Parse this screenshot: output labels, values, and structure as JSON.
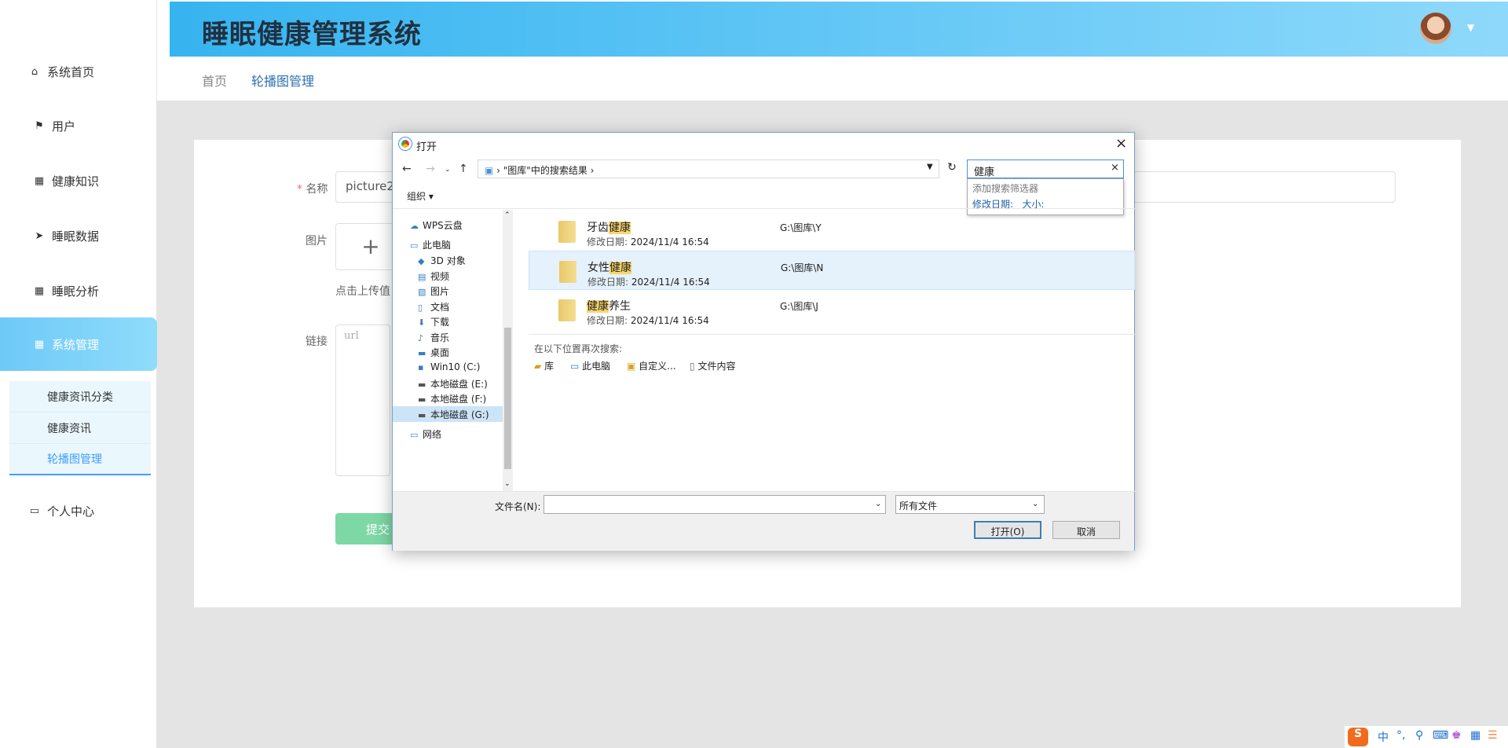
{
  "sidebar": {
    "items": [
      {
        "label": "系统首页",
        "icon": "home-icon"
      },
      {
        "label": "用户",
        "icon": "flag-icon"
      },
      {
        "label": "健康知识",
        "icon": "grid-icon"
      },
      {
        "label": "睡眠数据",
        "icon": "send-icon"
      },
      {
        "label": "睡眠分析",
        "icon": "grid-icon"
      },
      {
        "label": "系统管理",
        "icon": "grid-icon"
      },
      {
        "label": "个人中心",
        "icon": "wallet-icon"
      }
    ],
    "subitems": [
      {
        "label": "健康资讯分类"
      },
      {
        "label": "健康资讯"
      },
      {
        "label": "轮播图管理"
      }
    ],
    "active_color": "#6ec9f7"
  },
  "header": {
    "title": "睡眠健康管理系统"
  },
  "breadcrumb": {
    "home": "首页",
    "current": "轮播图管理"
  },
  "form": {
    "name_label": "名称",
    "required_mark": "*",
    "name_value": "picture2",
    "image_label": "图片",
    "upload_plus": "+",
    "upload_hint": "点击上传值",
    "link_label": "链接",
    "link_placeholder": "url",
    "submit_label": "提交"
  },
  "dialog": {
    "title": "打开",
    "close": "×",
    "address": "\"图库\"中的搜索结果",
    "search_value": "健康",
    "search_clear": "×",
    "popup_title": "添加搜索筛选器",
    "popup_filter_date": "修改日期:",
    "popup_filter_size": "大小:",
    "organize": "组织 ▾",
    "nav_items": [
      {
        "label": "WPS云盘",
        "icon": "cloud-icon"
      },
      {
        "label": "此电脑",
        "icon": "computer-icon"
      },
      {
        "label": "3D 对象",
        "icon": "cube-icon"
      },
      {
        "label": "视频",
        "icon": "video-icon"
      },
      {
        "label": "图片",
        "icon": "picture-icon"
      },
      {
        "label": "文档",
        "icon": "document-icon"
      },
      {
        "label": "下载",
        "icon": "download-icon"
      },
      {
        "label": "音乐",
        "icon": "music-icon"
      },
      {
        "label": "桌面",
        "icon": "desktop-icon"
      },
      {
        "label": "Win10 (C:)",
        "icon": "drive-icon"
      },
      {
        "label": "本地磁盘 (E:)",
        "icon": "drive-icon"
      },
      {
        "label": "本地磁盘 (F:)",
        "icon": "drive-icon"
      },
      {
        "label": "本地磁盘 (G:)",
        "icon": "drive-icon"
      },
      {
        "label": "网络",
        "icon": "network-icon"
      }
    ],
    "files": [
      {
        "prefix": "牙齿",
        "match": "健康",
        "suffix": "",
        "date_label": "修改日期:",
        "date": "2024/11/4 16:54",
        "path": "G:\\图库\\Y"
      },
      {
        "prefix": "女性",
        "match": "健康",
        "suffix": "",
        "date_label": "修改日期:",
        "date": "2024/11/4 16:54",
        "path": "G:\\图库\\N"
      },
      {
        "prefix": "",
        "match": "健康",
        "suffix": "养生",
        "date_label": "修改日期:",
        "date": "2024/11/4 16:54",
        "path": "G:\\图库\\J"
      }
    ],
    "search_again": "在以下位置再次搜索:",
    "again_items": [
      "库",
      "此电脑",
      "自定义...",
      "文件内容"
    ],
    "filename_label": "文件名(N):",
    "filetype": "所有文件",
    "open_label": "打开(O)",
    "cancel_label": "取消"
  },
  "ime": {
    "lang": "中"
  }
}
